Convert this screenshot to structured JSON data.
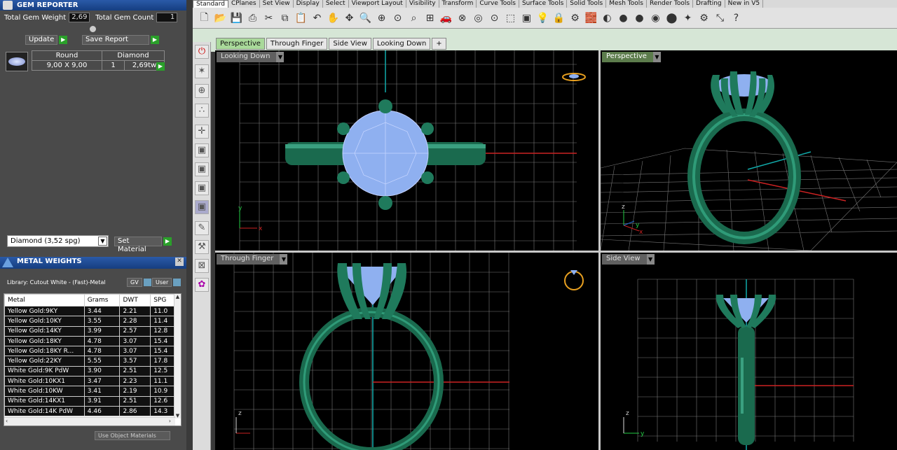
{
  "gem_reporter": {
    "title": "GEM REPORTER",
    "total_weight_label": "Total Gem Weight",
    "total_weight_value": "2,69",
    "total_count_label": "Total Gem Count",
    "total_count_value": "1",
    "update_label": "Update",
    "save_report_label": "Save Report",
    "row": {
      "shape": "Round",
      "size": "9,00 X 9,00",
      "type": "Diamond",
      "qty": "1",
      "weight": "2,69tw"
    },
    "material_select": "Diamond    (3,52 spg)",
    "set_material_label": "Set Material"
  },
  "metal_weights": {
    "title": "METAL WEIGHTS",
    "library": "Library: Cutout White - (Fast)-Metal",
    "gv_label": "GV",
    "user_label": "User",
    "columns": [
      "Metal",
      "Grams",
      "DWT",
      "SPG"
    ],
    "rows": [
      [
        "Yellow Gold:9KY",
        "3.44",
        "2.21",
        "11.0"
      ],
      [
        "Yellow Gold:10KY",
        "3.55",
        "2.28",
        "11.4"
      ],
      [
        "Yellow Gold:14KY",
        "3.99",
        "2.57",
        "12.8"
      ],
      [
        "Yellow Gold:18KY",
        "4.78",
        "3.07",
        "15.4"
      ],
      [
        "Yellow Gold:18KY R...",
        "4.78",
        "3.07",
        "15.4"
      ],
      [
        "Yellow Gold:22KY",
        "5.55",
        "3.57",
        "17.8"
      ],
      [
        "White Gold:9K PdW",
        "3.90",
        "2.51",
        "12.5"
      ],
      [
        "White Gold:10KX1",
        "3.47",
        "2.23",
        "11.1"
      ],
      [
        "White Gold:10KW",
        "3.41",
        "2.19",
        "10.9"
      ],
      [
        "White Gold:14KX1",
        "3.91",
        "2.51",
        "12.6"
      ],
      [
        "White Gold:14K PdW",
        "4.46",
        "2.86",
        "14.3"
      ]
    ],
    "use_object_materials": "Use Object Materials"
  },
  "menu_tabs": [
    "Standard",
    "CPlanes",
    "Set View",
    "Display",
    "Select",
    "Viewport Layout",
    "Visibility",
    "Transform",
    "Curve Tools",
    "Surface Tools",
    "Solid Tools",
    "Mesh Tools",
    "Render Tools",
    "Drafting",
    "New in V5"
  ],
  "view_tabs": [
    "Perspective",
    "Through Finger",
    "Side View",
    "Looking Down",
    "+"
  ],
  "viewports": {
    "top_left": "Looking Down",
    "top_right": "Perspective",
    "bottom_left": "Through Finger",
    "bottom_right": "Side View"
  },
  "axis_labels": {
    "x": "x",
    "y": "y",
    "z": "z"
  },
  "colors": {
    "ring": "#1f7a5c",
    "gem": "#8fb0f0",
    "grid": "#808080",
    "active_tab": "#a9d99a"
  }
}
